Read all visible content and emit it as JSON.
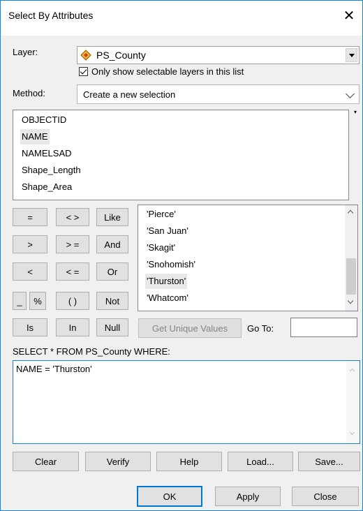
{
  "dialog": {
    "title": "Select By Attributes"
  },
  "layer": {
    "label": "Layer:",
    "value": "PS_County",
    "checkbox_label": "Only show selectable layers in this list",
    "checkbox_checked": true
  },
  "method": {
    "label": "Method:",
    "value": "Create a new selection"
  },
  "fields": [
    "OBJECTID",
    "NAME",
    "NAMELSAD",
    "Shape_Length",
    "Shape_Area"
  ],
  "selected_field": "NAME",
  "operators": {
    "eq": "=",
    "ne": "< >",
    "like": "Like",
    "gt": ">",
    "ge": "> =",
    "and": "And",
    "lt": "<",
    "le": "< =",
    "or": "Or",
    "underscore": "_",
    "percent": "%",
    "parens": "( )",
    "not": "Not",
    "is": "Is",
    "in": "In",
    "null": "Null"
  },
  "values": [
    "'Pierce'",
    "'San Juan'",
    "'Skagit'",
    "'Snohomish'",
    "'Thurston'",
    "'Whatcom'"
  ],
  "selected_value": "'Thurston'",
  "get_unique_values": "Get Unique Values",
  "go_to": {
    "label": "Go To:",
    "value": ""
  },
  "sql_prefix": "SELECT * FROM PS_County WHERE:",
  "expression": "NAME = 'Thurston'",
  "actions": {
    "clear": "Clear",
    "verify": "Verify",
    "help": "Help",
    "load": "Load...",
    "save": "Save..."
  },
  "footer": {
    "ok": "OK",
    "apply": "Apply",
    "close": "Close"
  }
}
